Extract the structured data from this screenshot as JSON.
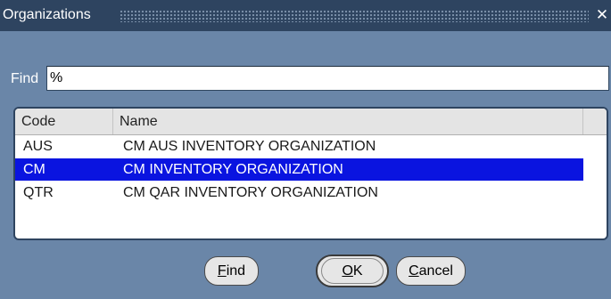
{
  "window": {
    "title": "Organizations",
    "close_symbol": "✕"
  },
  "find": {
    "label": "Find",
    "value": "%"
  },
  "list": {
    "columns": {
      "code": "Code",
      "name": "Name"
    },
    "rows": [
      {
        "code": "AUS",
        "name": "CM AUS INVENTORY ORGANIZATION",
        "selected": false
      },
      {
        "code": "CM",
        "name": "CM INVENTORY ORGANIZATION",
        "selected": true
      },
      {
        "code": "QTR",
        "name": "CM QAR INVENTORY ORGANIZATION",
        "selected": false
      }
    ]
  },
  "buttons": {
    "find": {
      "mnemonic": "F",
      "rest": "ind"
    },
    "ok": {
      "mnemonic": "O",
      "rest": "K"
    },
    "cancel": {
      "mnemonic": "C",
      "rest": "ancel"
    }
  },
  "colors": {
    "title_bar": "#2e4460",
    "window_background": "#6a86a8",
    "selection": "#0a14e0"
  }
}
